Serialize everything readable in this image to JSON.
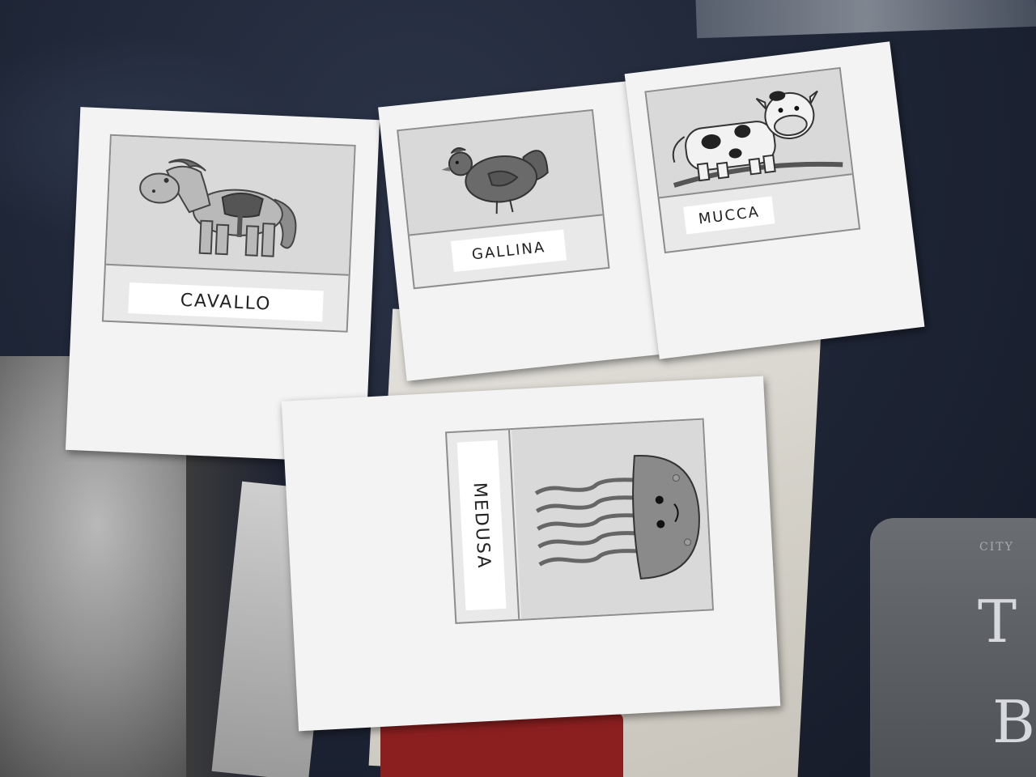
{
  "cards": [
    {
      "id": "horse",
      "label": "CAVALLO",
      "icon": "horse-illustration"
    },
    {
      "id": "hen",
      "label": "GALLINA",
      "icon": "hen-illustration"
    },
    {
      "id": "cow",
      "label": "MUCCA",
      "icon": "cow-illustration"
    },
    {
      "id": "jellyfish",
      "label": "MEDUSA",
      "icon": "jellyfish-illustration"
    }
  ],
  "background": {
    "blanket_color": "#1f2638",
    "shirt_print": {
      "small_text": "CITY",
      "letters": [
        "T",
        "B"
      ]
    }
  }
}
